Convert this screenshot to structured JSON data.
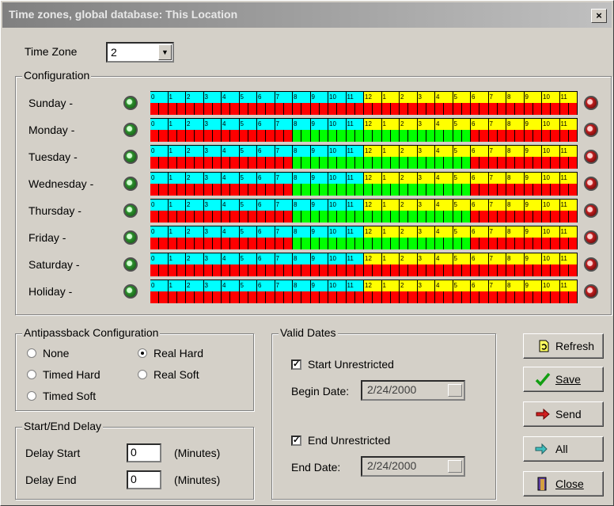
{
  "window": {
    "title": "Time zones, global database: This Location",
    "close_label": "×"
  },
  "timezone": {
    "label": "Time Zone",
    "value": "2"
  },
  "configuration": {
    "label": "Configuration",
    "hour_labels": [
      "0",
      "1",
      "2",
      "3",
      "4",
      "5",
      "6",
      "7",
      "8",
      "9",
      "10",
      "11",
      "12",
      "1",
      "2",
      "3",
      "4",
      "5",
      "6",
      "7",
      "8",
      "9",
      "10",
      "11"
    ],
    "colors": {
      "am_header": "#00ffff",
      "pm_header": "#ffff00",
      "inactive": "#ff0000",
      "active": "#00ff00"
    },
    "days": [
      {
        "name": "Sunday -",
        "active_hours": []
      },
      {
        "name": "Monday -",
        "active_hours": [
          8,
          9,
          10,
          11,
          12,
          13,
          14,
          15,
          16,
          17
        ]
      },
      {
        "name": "Tuesday -",
        "active_hours": [
          8,
          9,
          10,
          11,
          12,
          13,
          14,
          15,
          16,
          17
        ]
      },
      {
        "name": "Wednesday -",
        "active_hours": [
          8,
          9,
          10,
          11,
          12,
          13,
          14,
          15,
          16,
          17
        ]
      },
      {
        "name": "Thursday -",
        "active_hours": [
          8,
          9,
          10,
          11,
          12,
          13,
          14,
          15,
          16,
          17
        ]
      },
      {
        "name": "Friday -",
        "active_hours": [
          8,
          9,
          10,
          11,
          12,
          13,
          14,
          15,
          16,
          17
        ]
      },
      {
        "name": "Saturday -",
        "active_hours": []
      },
      {
        "name": "Holiday -",
        "active_hours": []
      }
    ]
  },
  "antipassback": {
    "label": "Antipassback Configuration",
    "options": [
      {
        "label": "None",
        "selected": false
      },
      {
        "label": "Real Hard",
        "selected": true
      },
      {
        "label": "Timed Hard",
        "selected": false
      },
      {
        "label": "Real Soft",
        "selected": false
      },
      {
        "label": "Timed Soft",
        "selected": false
      }
    ]
  },
  "delay": {
    "label": "Start/End Delay",
    "start_label": "Delay Start",
    "start_value": "0",
    "end_label": "Delay End",
    "end_value": "0",
    "unit": "(Minutes)"
  },
  "valid_dates": {
    "label": "Valid Dates",
    "start_unrestricted_label": "Start Unrestricted",
    "start_unrestricted": true,
    "begin_label": "Begin Date:",
    "begin_value": "2/24/2000",
    "end_unrestricted_label": "End Unrestricted",
    "end_unrestricted": true,
    "end_label": "End Date:",
    "end_value": "2/24/2000"
  },
  "buttons": {
    "refresh": "Refresh",
    "save": "Save",
    "send": "Send",
    "all": "All",
    "close": "Close"
  }
}
